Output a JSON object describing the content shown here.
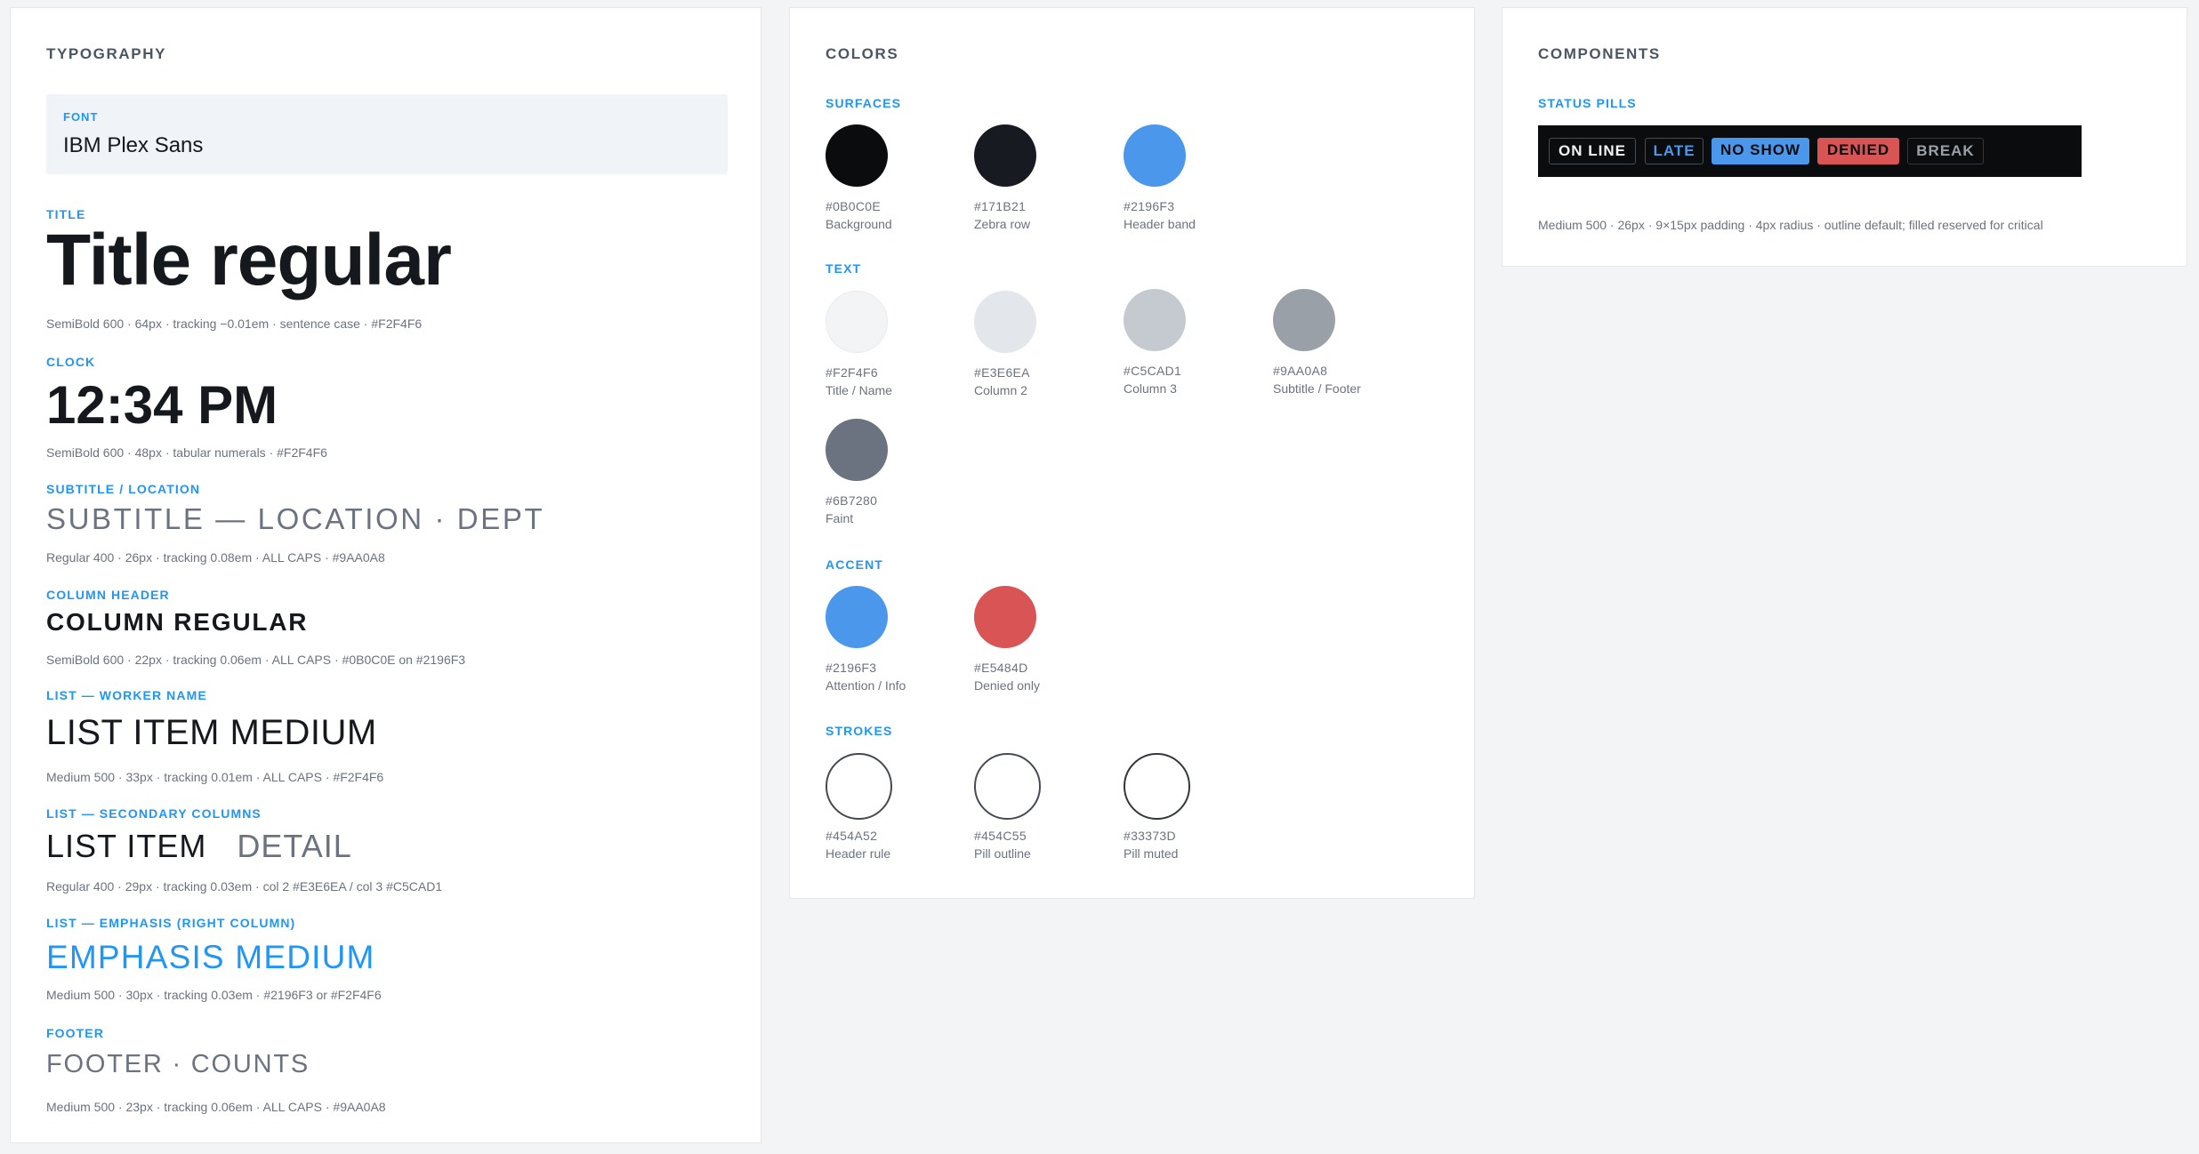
{
  "typography": {
    "title": "TYPOGRAPHY",
    "font": {
      "label": "FONT",
      "value": "IBM Plex Sans"
    },
    "sections": {
      "title": {
        "label": "TITLE",
        "sample": "Title regular",
        "spec": "SemiBold 600 · 64px · tracking −0.01em · sentence case · #F2F4F6"
      },
      "clock": {
        "label": "CLOCK",
        "sample": "12:34 PM",
        "spec": "SemiBold 600 · 48px · tabular numerals · #F2F4F6"
      },
      "subtitle": {
        "label": "SUBTITLE / LOCATION",
        "sample": "SUBTITLE — LOCATION · DEPT",
        "spec": "Regular 400 · 26px · tracking 0.08em · ALL CAPS · #9AA0A8"
      },
      "column": {
        "label": "COLUMN HEADER",
        "sample": "COLUMN REGULAR",
        "spec": "SemiBold 600 · 22px · tracking 0.06em · ALL CAPS · #0B0C0E on #2196F3"
      },
      "list": {
        "label": "LIST — WORKER NAME",
        "sample": "LIST ITEM MEDIUM",
        "spec": "Medium 500 · 33px · tracking 0.01em · ALL CAPS · #F2F4F6"
      },
      "secondary": {
        "label": "LIST — SECONDARY COLUMNS",
        "sample_a": "LIST ITEM",
        "sample_b": "DETAIL",
        "spec": "Regular 400 · 29px · tracking 0.03em · col 2 #E3E6EA / col 3 #C5CAD1"
      },
      "emphasis": {
        "label": "LIST — EMPHASIS (RIGHT COLUMN)",
        "sample": "EMPHASIS MEDIUM",
        "spec": "Medium 500 · 30px · tracking 0.03em · #2196F3 or #F2F4F6"
      },
      "footer": {
        "label": "FOOTER",
        "sample": "FOOTER · COUNTS",
        "spec": "Medium 500 · 23px · tracking 0.06em · ALL CAPS · #9AA0A8"
      }
    }
  },
  "colors": {
    "title": "COLORS",
    "surfaces": {
      "label": "SURFACES",
      "items": [
        {
          "hex": "#0B0C0E",
          "name": "Background",
          "color": "#0B0C0E"
        },
        {
          "hex": "#171B21",
          "name": "Zebra row",
          "color": "#171B21"
        },
        {
          "hex": "#2196F3",
          "name": "Header band",
          "color": "#4A97EC"
        }
      ]
    },
    "text": {
      "label": "TEXT",
      "items": [
        {
          "hex": "#F2F4F6",
          "name": "Title / Name",
          "color": "#F2F4F6"
        },
        {
          "hex": "#E3E6EA",
          "name": "Column 2",
          "color": "#E3E6EA"
        },
        {
          "hex": "#C5CAD1",
          "name": "Column 3",
          "color": "#C5CAD1"
        },
        {
          "hex": "#9AA0A8",
          "name": "Subtitle / Footer",
          "color": "#9AA0A8"
        },
        {
          "hex": "#6B7280",
          "name": "Faint",
          "color": "#6B7280"
        }
      ]
    },
    "accent": {
      "label": "ACCENT",
      "items": [
        {
          "hex": "#2196F3",
          "name": "Attention / Info",
          "color": "#4A97EC"
        },
        {
          "hex": "#E5484D",
          "name": "Denied only",
          "color": "#D95455"
        }
      ]
    },
    "strokes": {
      "label": "STROKES",
      "items": [
        {
          "hex": "#454A52",
          "name": "Header rule",
          "color": "#454A52"
        },
        {
          "hex": "#454C55",
          "name": "Pill outline",
          "color": "#454C55"
        },
        {
          "hex": "#33373D",
          "name": "Pill muted",
          "color": "#33373D"
        }
      ]
    }
  },
  "components": {
    "title": "COMPONENTS",
    "status_label": "STATUS PILLS",
    "pills": [
      {
        "label": "ON LINE",
        "style": "outline"
      },
      {
        "label": "LATE",
        "style": "outline-accent"
      },
      {
        "label": "NO SHOW",
        "style": "filled-accent"
      },
      {
        "label": "DENIED",
        "style": "filled-danger"
      },
      {
        "label": "BREAK",
        "style": "muted"
      }
    ],
    "spec": "Medium 500 · 26px · 9×15px padding · 4px radius · outline default; filled reserved for critical"
  }
}
